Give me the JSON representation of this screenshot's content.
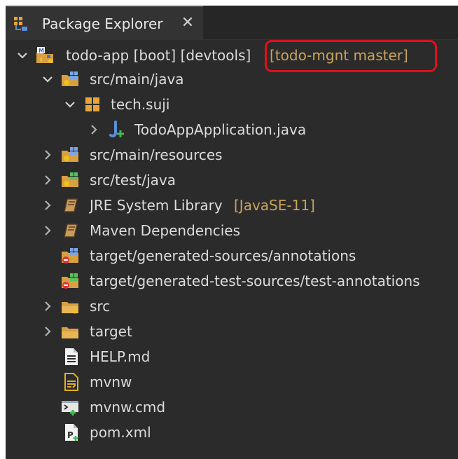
{
  "tab": {
    "title": "Package Explorer",
    "close_glyph": "✕"
  },
  "project": {
    "name": "todo-app [boot] [devtools]",
    "repo": "[todo-mgnt master]"
  },
  "tree": [
    {
      "label": "src/main/java",
      "icon": "java-source-folder-icon"
    },
    {
      "label": "tech.suji",
      "icon": "package-icon"
    },
    {
      "label": "TodoAppApplication.java",
      "icon": "java-class-icon"
    },
    {
      "label": "src/main/resources",
      "icon": "source-folder-icon"
    },
    {
      "label": "src/test/java",
      "icon": "test-source-folder-icon"
    },
    {
      "label": "JRE System Library",
      "suffix": "[JavaSE-11]",
      "icon": "library-icon"
    },
    {
      "label": "Maven Dependencies",
      "icon": "library-icon"
    },
    {
      "label": "target/generated-sources/annotations",
      "icon": "generated-source-folder-icon"
    },
    {
      "label": "target/generated-test-sources/test-annotations",
      "icon": "generated-source-folder-icon"
    },
    {
      "label": "src",
      "icon": "folder-icon"
    },
    {
      "label": "target",
      "icon": "folder-icon"
    },
    {
      "label": "HELP.md",
      "icon": "text-file-icon"
    },
    {
      "label": "mvnw",
      "icon": "script-file-icon"
    },
    {
      "label": "mvnw.cmd",
      "icon": "cmd-file-icon"
    },
    {
      "label": "pom.xml",
      "icon": "pom-file-icon"
    }
  ],
  "colors": {
    "background": "#2b2b2b",
    "text": "#dcdcdc",
    "decoration": "#c9a35b",
    "annotation": "#e0101a"
  }
}
